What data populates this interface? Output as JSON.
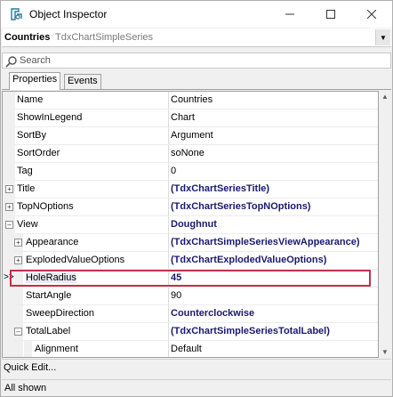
{
  "window": {
    "title": "Object Inspector"
  },
  "selector": {
    "object": "Countries",
    "class": "TdxChartSimpleSeries"
  },
  "search": {
    "placeholder": "Search"
  },
  "tabs": [
    {
      "label": "Properties",
      "active": true
    },
    {
      "label": "Events",
      "active": false
    }
  ],
  "properties": [
    {
      "name": "Name",
      "value": "Countries",
      "bold": false,
      "expander": "",
      "depth": 0
    },
    {
      "name": "ShowInLegend",
      "value": "Chart",
      "bold": false,
      "expander": "",
      "depth": 0
    },
    {
      "name": "SortBy",
      "value": "Argument",
      "bold": false,
      "expander": "",
      "depth": 0
    },
    {
      "name": "SortOrder",
      "value": "soNone",
      "bold": false,
      "expander": "",
      "depth": 0
    },
    {
      "name": "Tag",
      "value": "0",
      "bold": false,
      "expander": "",
      "depth": 0
    },
    {
      "name": "Title",
      "value": "(TdxChartSeriesTitle)",
      "bold": true,
      "expander": "+",
      "depth": 0
    },
    {
      "name": "TopNOptions",
      "value": "(TdxChartSeriesTopNOptions)",
      "bold": true,
      "expander": "+",
      "depth": 0
    },
    {
      "name": "View",
      "value": "Doughnut",
      "bold": true,
      "expander": "-",
      "depth": 0
    },
    {
      "name": "Appearance",
      "value": "(TdxChartSimpleSeriesViewAppearance)",
      "bold": true,
      "expander": "+",
      "depth": 1
    },
    {
      "name": "ExplodedValueOptions",
      "value": "(TdxChartExplodedValueOptions)",
      "bold": true,
      "expander": "+",
      "depth": 1
    },
    {
      "name": "HoleRadius",
      "value": "45",
      "bold": true,
      "expander": "",
      "depth": 1,
      "selected": true
    },
    {
      "name": "StartAngle",
      "value": "90",
      "bold": false,
      "expander": "",
      "depth": 1
    },
    {
      "name": "SweepDirection",
      "value": "Counterclockwise",
      "bold": true,
      "expander": "",
      "depth": 1
    },
    {
      "name": "TotalLabel",
      "value": "(TdxChartSimpleSeriesTotalLabel)",
      "bold": true,
      "expander": "-",
      "depth": 1
    },
    {
      "name": "Alignment",
      "value": "Default",
      "bold": false,
      "expander": "",
      "depth": 2
    }
  ],
  "selected_marker": ">>",
  "quick_edit": "Quick Edit...",
  "status": "All shown",
  "colors": {
    "selection_border": "#c0324a",
    "bold_value": "#1a1a6e"
  }
}
